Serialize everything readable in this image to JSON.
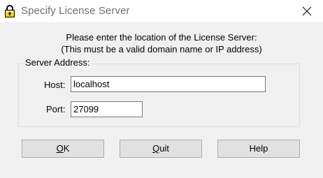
{
  "window": {
    "title": "Specify License Server",
    "icon": "padlock-icon",
    "close_icon": "close-icon"
  },
  "prompt": {
    "line1": "Please enter the location of the License Server:",
    "line2": "(This must be a valid domain name or IP address)"
  },
  "server_group": {
    "label": "Server Address:",
    "host_label": "Host:",
    "host_value": "localhost",
    "port_label": "Port:",
    "port_value": "27099"
  },
  "buttons": {
    "ok": {
      "mnemonic": "O",
      "rest": "K"
    },
    "quit": {
      "mnemonic": "Q",
      "rest": "uit"
    },
    "help": "Help"
  },
  "colors": {
    "dialog_background": "#f0f0f0",
    "titlebar_background": "#ffffff",
    "button_face": "#e1e1e1",
    "icon_yellow": "#f4d21f"
  }
}
